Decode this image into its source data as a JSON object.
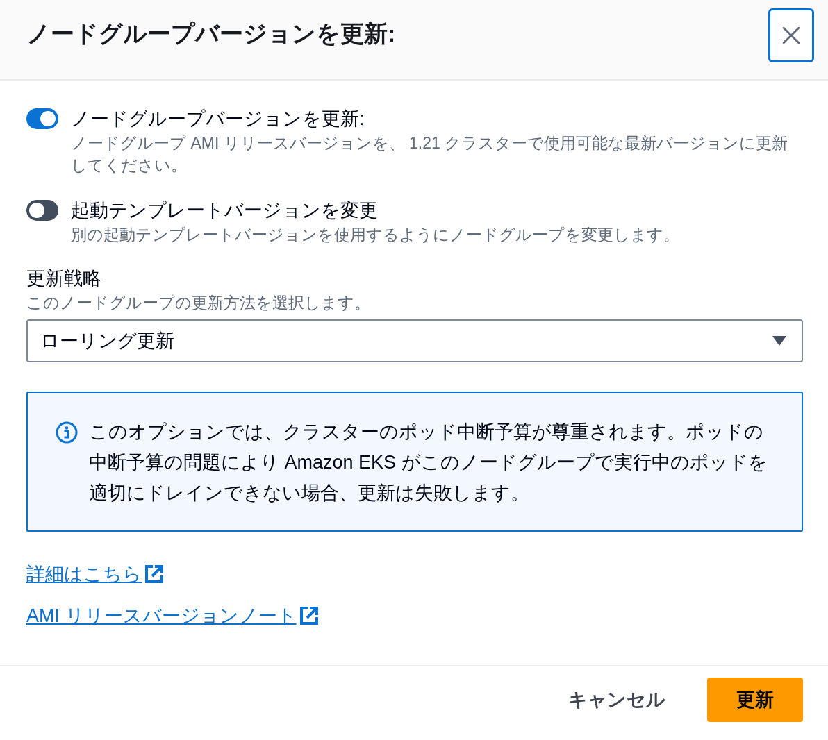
{
  "dialog": {
    "title": "ノードグループバージョンを更新:"
  },
  "toggles": [
    {
      "label": "ノードグループバージョンを更新:",
      "description": "ノードグループ AMI リリースバージョンを、 1.21 クラスターで使用可能な最新バージョンに更新してください。",
      "on": true
    },
    {
      "label": "起動テンプレートバージョンを変更",
      "description": "別の起動テンプレートバージョンを使用するようにノードグループを変更します。",
      "on": false
    }
  ],
  "update_strategy": {
    "label": "更新戦略",
    "description": "このノードグループの更新方法を選択します。",
    "value": "ローリング更新"
  },
  "info_alert": {
    "text": "このオプションでは、クラスターのポッド中断予算が尊重されます。ポッドの中断予算の問題により Amazon EKS がこのノードグループで実行中のポッドを適切にドレインできない場合、更新は失敗します。"
  },
  "links": [
    "詳細はこちら",
    "AMI リリースバージョンノート"
  ],
  "buttons": [
    {
      "label": "キャンセル",
      "kind": "link"
    },
    {
      "label": "更新",
      "kind": "primary"
    }
  ]
}
